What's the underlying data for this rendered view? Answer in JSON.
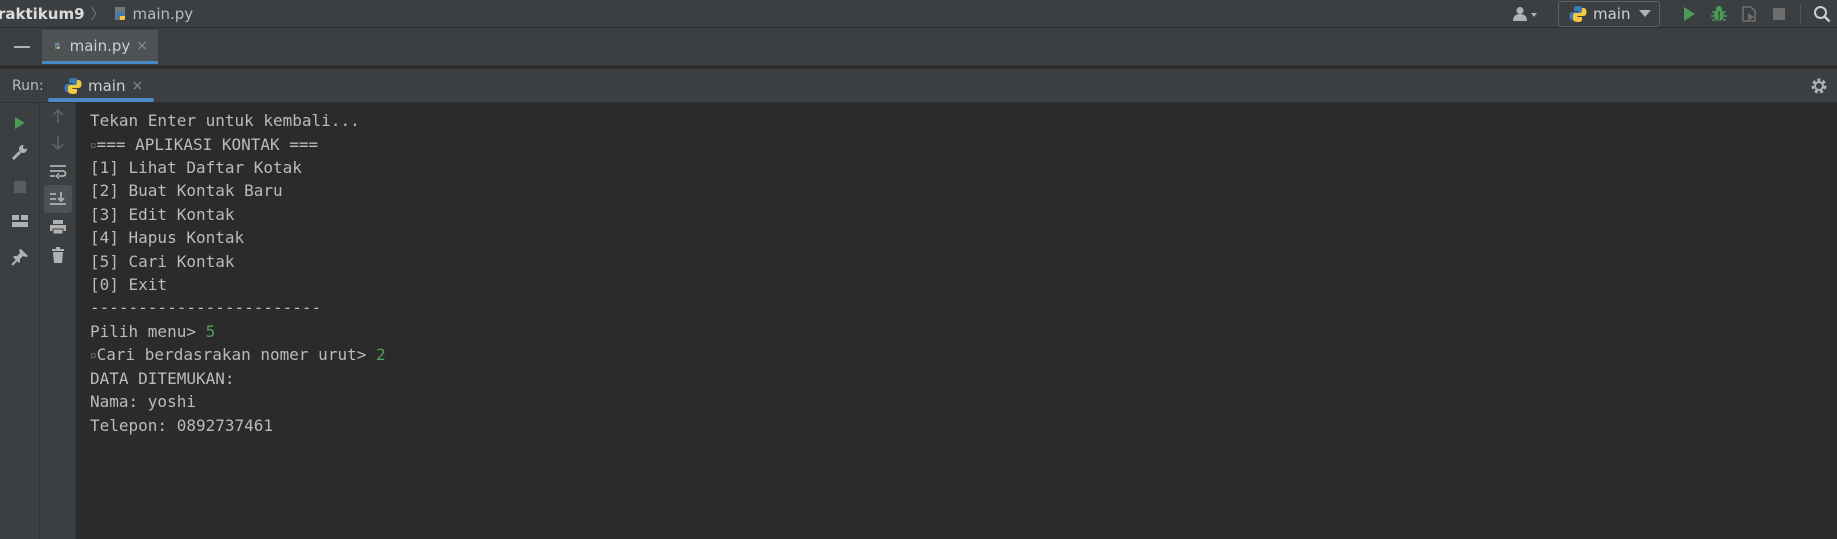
{
  "navbar": {
    "project": "raktikum9",
    "separator": "〉",
    "file": "main.py",
    "run_config": "main"
  },
  "editor_tabs": [
    {
      "label": "main.py",
      "close": "×"
    }
  ],
  "run_panel": {
    "title": "Run:",
    "tab_label": "main",
    "tab_close": "×"
  },
  "console": {
    "lines": [
      {
        "text": "Tekan Enter untuk kembali...",
        "input": "",
        "marker": ""
      },
      {
        "text": "=== APLIKASI KONTAK ===",
        "input": "",
        "marker": "▫"
      },
      {
        "text": "[1] Lihat Daftar Kotak",
        "input": "",
        "marker": ""
      },
      {
        "text": "[2] Buat Kontak Baru",
        "input": "",
        "marker": ""
      },
      {
        "text": "[3] Edit Kontak",
        "input": "",
        "marker": ""
      },
      {
        "text": "[4] Hapus Kontak",
        "input": "",
        "marker": ""
      },
      {
        "text": "[5] Cari Kontak",
        "input": "",
        "marker": ""
      },
      {
        "text": "[0] Exit",
        "input": "",
        "marker": ""
      },
      {
        "text": "------------------------",
        "input": "",
        "marker": ""
      },
      {
        "text": "Pilih menu> ",
        "input": "5",
        "marker": ""
      },
      {
        "text": "Cari berdasrakan nomer urut> ",
        "input": "2",
        "marker": "▫"
      },
      {
        "text": "DATA DITEMUKAN:",
        "input": "",
        "marker": ""
      },
      {
        "text": "Nama: yoshi",
        "input": "",
        "marker": ""
      },
      {
        "text": "Telepon: 0892737461",
        "input": "",
        "marker": ""
      }
    ]
  },
  "colors": {
    "background": "#2b2b2b",
    "chrome": "#3c3f41",
    "accent": "#4a88c7",
    "run_green": "#4fa25a",
    "user_input": "#4fa25a"
  }
}
